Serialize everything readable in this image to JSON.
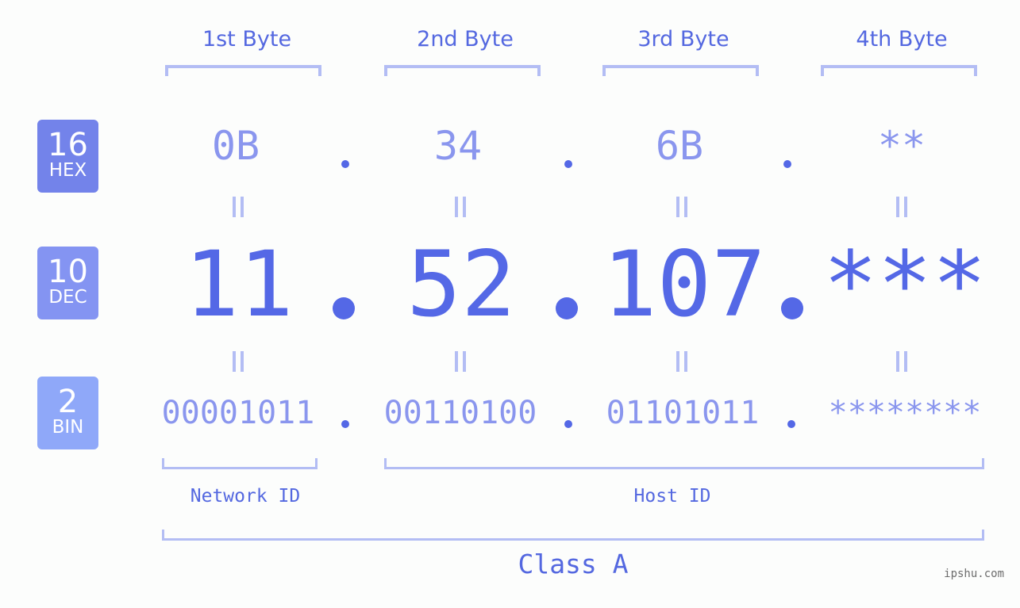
{
  "bytes": [
    {
      "label": "1st Byte",
      "hex": "0B",
      "dec": "11",
      "bin": "00001011"
    },
    {
      "label": "2nd Byte",
      "hex": "34",
      "dec": "52",
      "bin": "00110100"
    },
    {
      "label": "3rd Byte",
      "hex": "6B",
      "dec": "107",
      "bin": "01101011"
    },
    {
      "label": "4th Byte",
      "hex": "**",
      "dec": "***",
      "bin": "********"
    }
  ],
  "badges": {
    "hex": {
      "num": "16",
      "label": "HEX",
      "color": "#7383ea"
    },
    "dec": {
      "num": "10",
      "label": "DEC",
      "color": "#8494f2"
    },
    "bin": {
      "num": "2",
      "label": "BIN",
      "color": "#8fa8f9"
    }
  },
  "network_label": "Network ID",
  "host_label": "Host ID",
  "class_label": "Class A",
  "watermark": "ipshu.com",
  "colors": {
    "accent": "#5468e6",
    "light": "#8a96ee",
    "bracket": "#b3bdf4"
  }
}
